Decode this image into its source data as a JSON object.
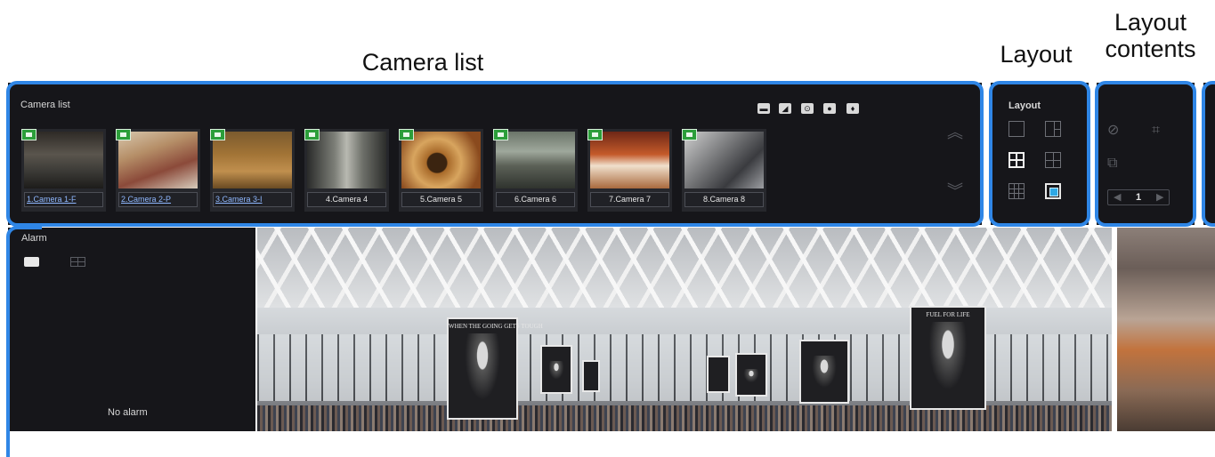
{
  "annotations": {
    "camera_list": "Camera list",
    "layout": "Layout",
    "layout_contents_line1": "Layout",
    "layout_contents_line2": "contents"
  },
  "camera_list": {
    "title": "Camera list",
    "toolbar_icons": [
      "fullscreen-icon",
      "snapshot-icon",
      "record-icon",
      "stop-icon",
      "microphone-icon"
    ],
    "cameras": [
      {
        "label": "1.Camera 1-F",
        "recording": true,
        "linked": true
      },
      {
        "label": "2.Camera 2-P",
        "recording": true,
        "linked": true
      },
      {
        "label": "3.Camera 3-I",
        "recording": true,
        "linked": true
      },
      {
        "label": "4.Camera 4",
        "recording": true,
        "linked": false
      },
      {
        "label": "5.Camera 5",
        "recording": true,
        "linked": false
      },
      {
        "label": "6.Camera 6",
        "recording": true,
        "linked": false
      },
      {
        "label": "7.Camera 7",
        "recording": true,
        "linked": false
      },
      {
        "label": "8.Camera 8",
        "recording": true,
        "linked": false
      }
    ]
  },
  "layout_panel": {
    "title": "Layout",
    "options": [
      "single",
      "1+3",
      "2x2",
      "1+5",
      "3x3",
      "custom"
    ],
    "selected": "2x2"
  },
  "layout_contents": {
    "page_value": "1"
  },
  "alarm_panel": {
    "title": "Alarm",
    "empty_text": "No alarm"
  },
  "main_view": {
    "banners": [
      "WHEN THE GOING GETS TOUGH",
      "FUEL FOR LIFE"
    ]
  },
  "colors": {
    "annotation_border": "#2f86e6",
    "panel_bg": "#16161a",
    "recording_badge": "#2c9e3a",
    "accent": "#2fa9e6"
  }
}
